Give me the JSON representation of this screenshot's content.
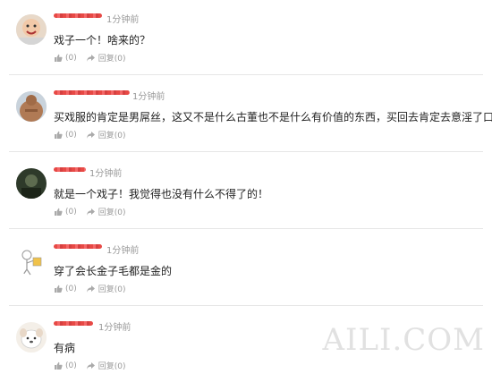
{
  "comments": [
    {
      "username": "",
      "time": "1分钟前",
      "text": "戏子一个！啥来的？",
      "like_label": "(0)",
      "reply_label": "回复(0)"
    },
    {
      "username": "",
      "time": "1分钟前",
      "text": "买戏服的肯定是男屌丝，这又不是什么古董也不是什么有价值的东西，买回去肯定去意淫了口",
      "like_label": "(0)",
      "reply_label": "回复(0)"
    },
    {
      "username": "",
      "time": "1分钟前",
      "text": "就是一个戏子！我觉得也没有什么不得了的！",
      "like_label": "(0)",
      "reply_label": "回复(0)"
    },
    {
      "username": "",
      "time": "1分钟前",
      "text": "穿了会长金子毛都是金的",
      "like_label": "(0)",
      "reply_label": "回复(0)"
    },
    {
      "username": "",
      "time": "1分钟前",
      "text": "有病",
      "like_label": "(0)",
      "reply_label": "回复(0)"
    }
  ],
  "watermark": "AILI.COM",
  "icons": {
    "like": "thumbs-up-icon",
    "reply": "reply-arrow-icon"
  },
  "colors": {
    "redaction": "#e53935",
    "divider": "#e6e6e6",
    "meta_text": "#999999"
  }
}
